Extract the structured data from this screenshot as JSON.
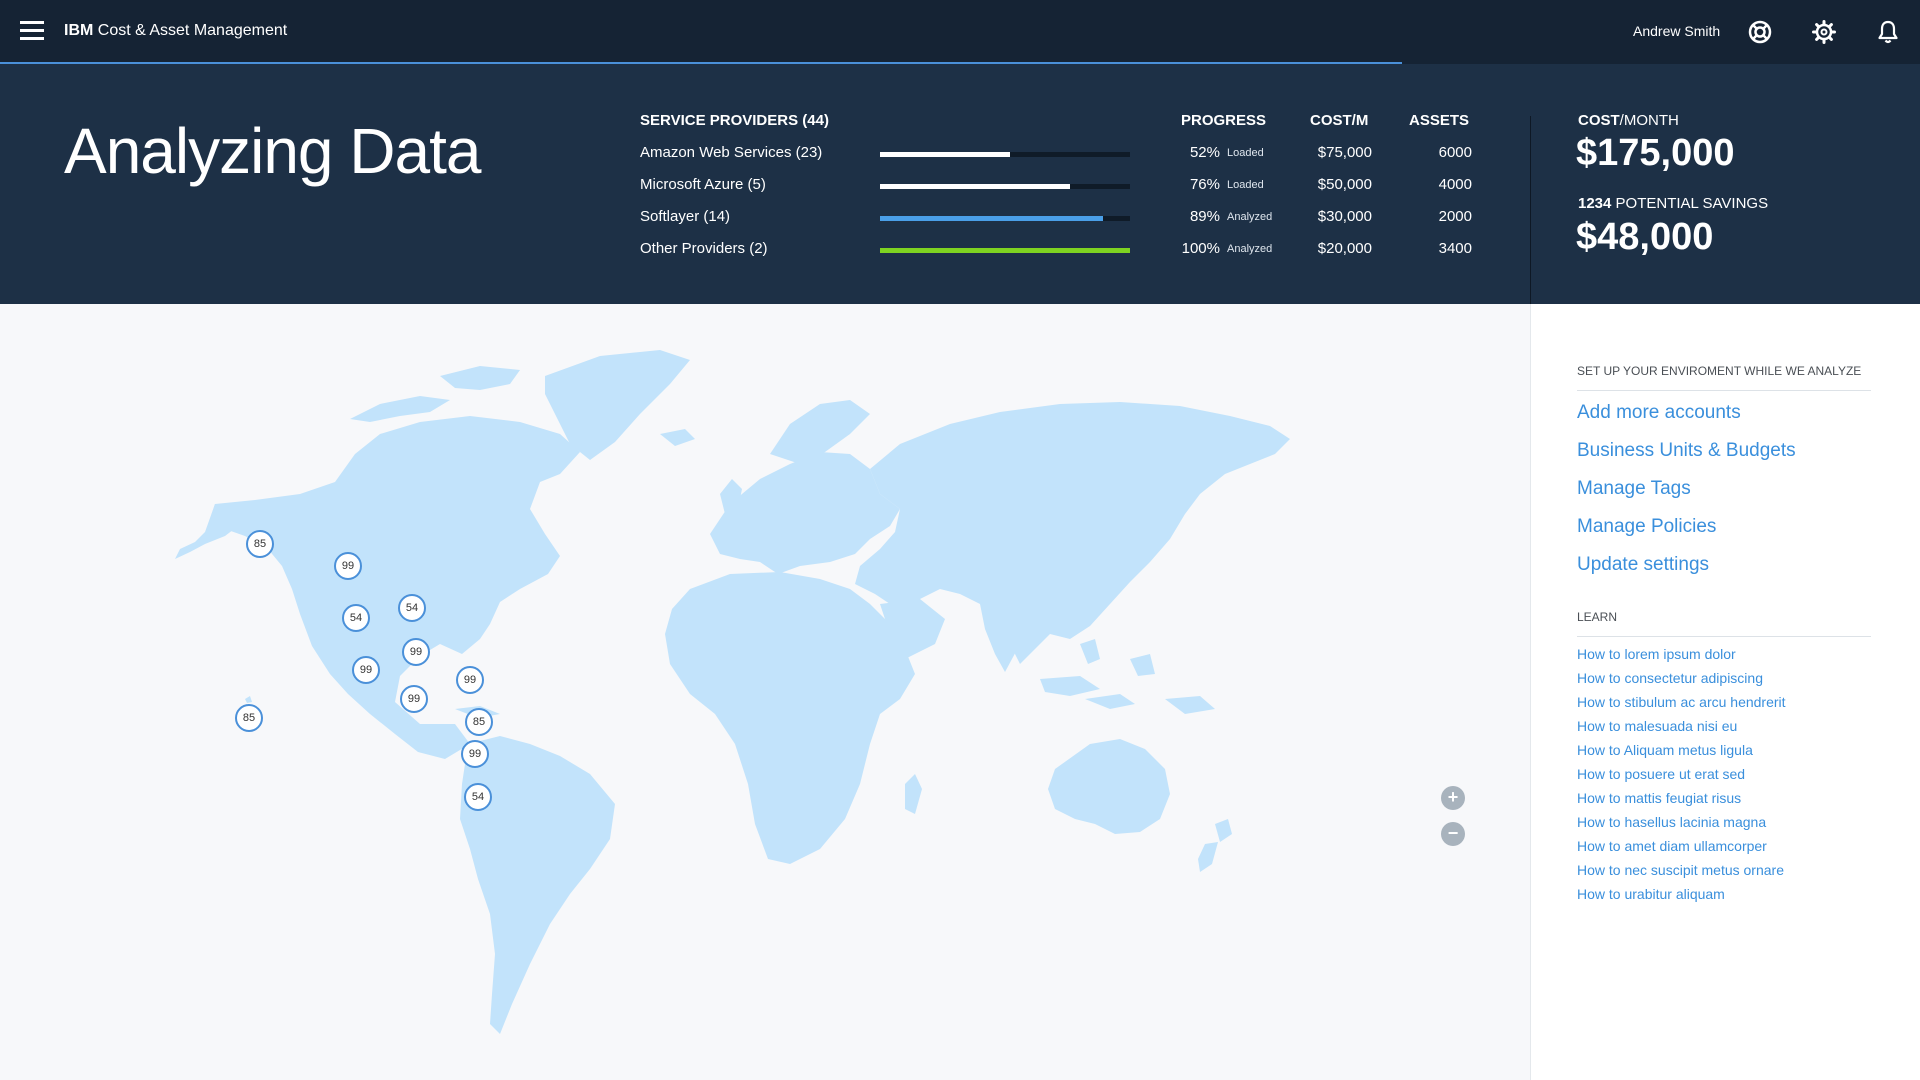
{
  "app": {
    "title_bold": "IBM",
    "title_rest": " Cost & Asset Management",
    "user_name": "Andrew Smith",
    "load_progress": 0.73
  },
  "header": {
    "page_title": "Analyzing Data",
    "col_providers": "SERVICE PROVIDERS (44)",
    "col_progress": "PROGRESS",
    "col_cost": "COST/M",
    "col_assets": "ASSETS",
    "providers": [
      {
        "name": "Amazon Web Services (23)",
        "progress": 52,
        "pct": "52%",
        "status": "Loaded",
        "cost": "$75,000",
        "assets": "6000",
        "bar_color": "#ffffff"
      },
      {
        "name": "Microsoft Azure (5)",
        "progress": 76,
        "pct": "76%",
        "status": "Loaded",
        "cost": "$50,000",
        "assets": "4000",
        "bar_color": "#ffffff"
      },
      {
        "name": "Softlayer (14)",
        "progress": 89,
        "pct": "89%",
        "status": "Analyzed",
        "cost": "$30,000",
        "assets": "2000",
        "bar_color": "#4a9fe8"
      },
      {
        "name": "Other Providers (2)",
        "progress": 100,
        "pct": "100%",
        "status": "Analyzed",
        "cost": "$20,000",
        "assets": "3400",
        "bar_color": "#7ed321"
      }
    ],
    "cost_month_bold": "COST",
    "cost_month_rest": "/MONTH",
    "cost_month_value": "$175,000",
    "savings_bold": "1234",
    "savings_rest": " POTENTIAL SAVINGS",
    "savings_value": "$48,000"
  },
  "map": {
    "land_color": "#c2e3fb",
    "markers": [
      "85",
      "99",
      "54",
      "54",
      "99",
      "99",
      "99",
      "99",
      "85",
      "99",
      "54",
      "85"
    ],
    "zoom_in": "+",
    "zoom_out": "−"
  },
  "sidebar": {
    "setup_heading": "SET UP YOUR ENVIROMENT WHILE WE ANALYZE",
    "setup_links": [
      "Add more accounts",
      "Business Units & Budgets",
      "Manage Tags",
      "Manage Policies",
      "Update settings"
    ],
    "learn_heading": "LEARN",
    "learn_links": [
      "How to lorem ipsum dolor",
      "How to consectetur adipiscing",
      "How to stibulum ac arcu hendrerit",
      "How to malesuada nisi eu",
      "How to Aliquam metus ligula",
      "How to posuere ut erat sed",
      "How to mattis feugiat risus",
      "How to hasellus lacinia magna",
      "How to amet diam ullamcorper",
      "How to nec suscipit metus ornare",
      "How to urabitur aliquam"
    ]
  }
}
